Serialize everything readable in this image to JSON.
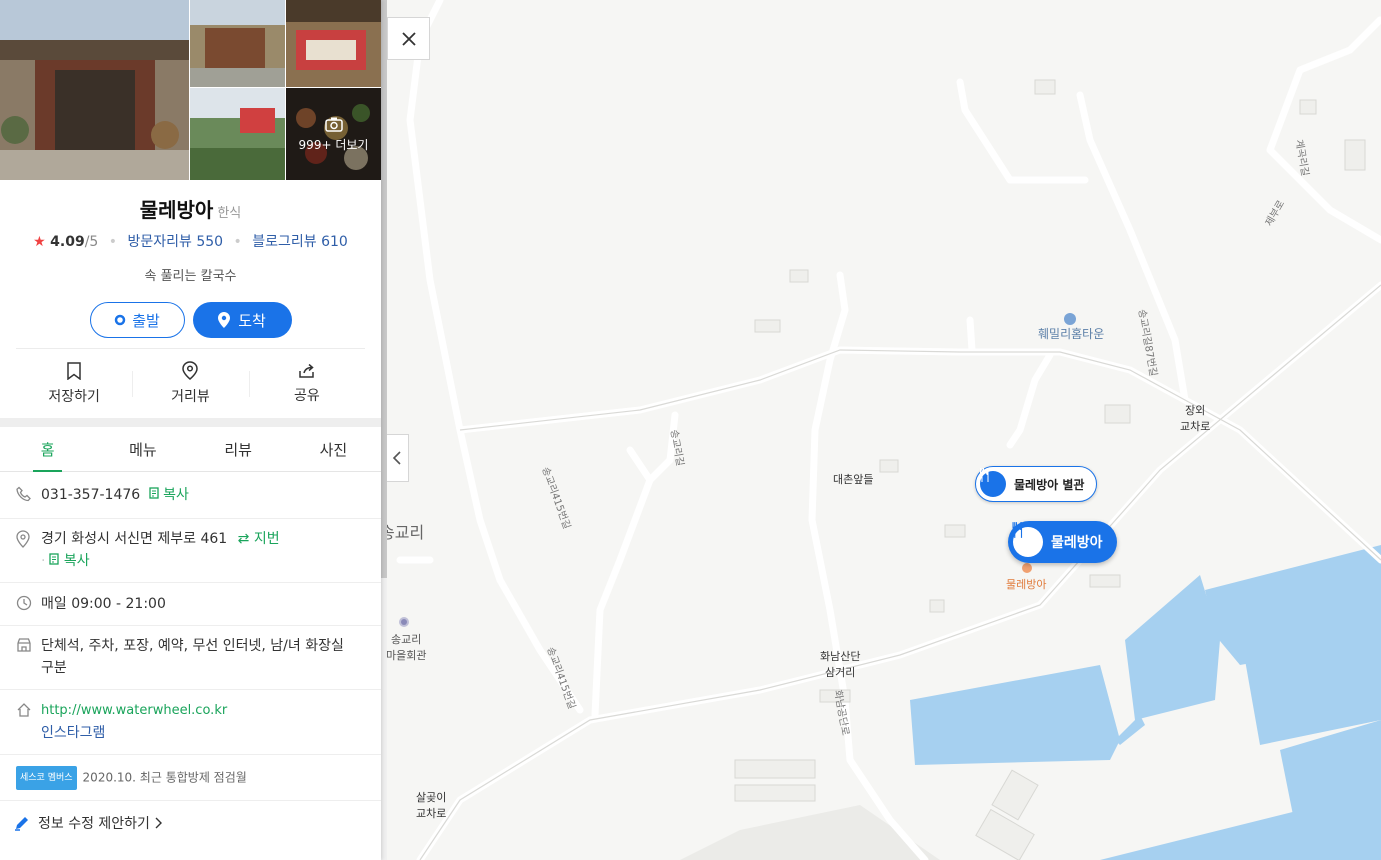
{
  "place": {
    "name": "물레방아",
    "category": "한식",
    "rating_star": "★",
    "rating": "4.09",
    "rating_max": "/5",
    "visit_reviews": "방문자리뷰 550",
    "blog_reviews": "블로그리뷰 610",
    "description": "속 풀리는 칼국수",
    "photos_more": "999+ 더보기"
  },
  "route": {
    "start_label": "출발",
    "arrive_label": "도착"
  },
  "actions": {
    "save": "저장하기",
    "street": "거리뷰",
    "share": "공유"
  },
  "tabs": [
    "홈",
    "메뉴",
    "리뷰",
    "사진"
  ],
  "info": {
    "phone": "031-357-1476",
    "copy": "복사",
    "address": "경기 화성시 서신면 제부로 461",
    "jibun": "지번",
    "hours": "매일 09:00 - 21:00",
    "amenities": "단체석, 주차, 포장, 예약, 무선 인터넷, 남/녀 화장실 구분",
    "website": "http://www.waterwheel.co.kr",
    "instagram": "인스타그램",
    "cesco_badge": "세스코 멤버스",
    "cesco_text": "2020.10. 최근 통합방제 점검월",
    "suggest": "정보 수정 제안하기"
  },
  "map": {
    "pin_annex": "물레방아 별관",
    "pin_main": "물레방아",
    "poi_main": "물레방아",
    "labels": {
      "songgyori": "송교리",
      "hwemilli": "훼밀리홈타운",
      "jangoe": "장외\n교차로",
      "daechon": "대촌앞들",
      "hwanam": "화남산단\n삼거리",
      "salgoji": "살곶이\n교차로",
      "songgyori_hall": "송교리\n마을회관",
      "road_songgyo": "송교리길",
      "road_gyegok": "계곡리길",
      "road_jebu": "제부로",
      "road_hwanam": "화남공단로",
      "road_songgyo415a": "송교리415번길",
      "road_songgyo415b": "송교리415번길",
      "road_songgyo87": "송교리길87번길"
    }
  },
  "colors": {
    "accent": "#1a73e8",
    "green": "#1aa45b",
    "water": "#a6d0f0"
  }
}
